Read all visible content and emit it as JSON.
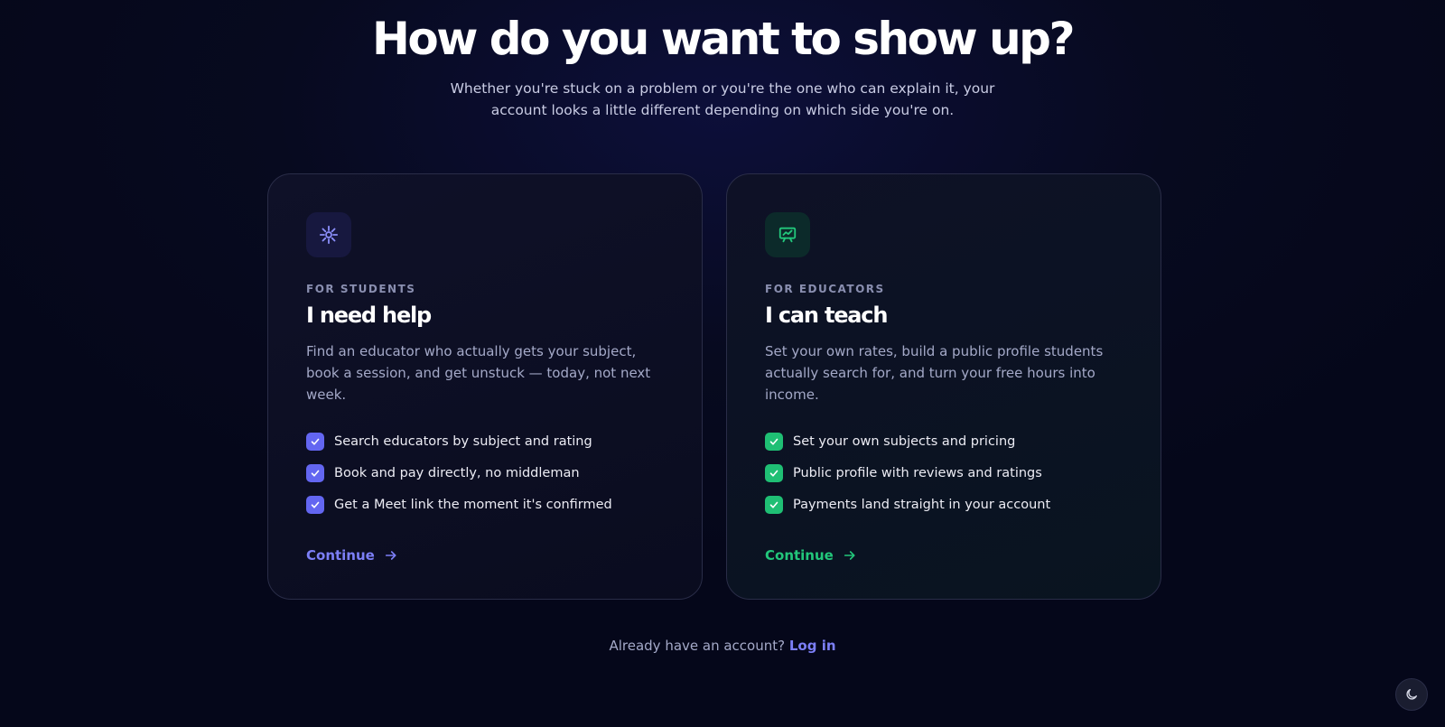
{
  "header": {
    "title": "How do you want to show up?",
    "subtitle": "Whether you're stuck on a problem or you're the one who can explain it, your account looks a little different depending on which side you're on."
  },
  "cards": {
    "students": {
      "icon": "sparkle-icon",
      "eyebrow": "FOR STUDENTS",
      "heading": "I need help",
      "description": "Find an educator who actually gets your subject, book a session, and get unstuck — today, not next week.",
      "features": [
        "Search educators by subject and rating",
        "Book and pay directly, no middleman",
        "Get a Meet link the moment it's confirmed"
      ],
      "cta": "Continue",
      "accent": "#6366f1"
    },
    "educators": {
      "icon": "presentation-board-icon",
      "eyebrow": "FOR EDUCATORS",
      "heading": "I can teach",
      "description": "Set your own rates, build a public profile students actually search for, and turn your free hours into income.",
      "features": [
        "Set your own subjects and pricing",
        "Public profile with reviews and ratings",
        "Payments land straight in your account"
      ],
      "cta": "Continue",
      "accent": "#1fbf74"
    }
  },
  "footer": {
    "prompt": "Already have an account?",
    "login": "Log in"
  },
  "theme_toggle": {
    "icon": "moon-icon"
  }
}
